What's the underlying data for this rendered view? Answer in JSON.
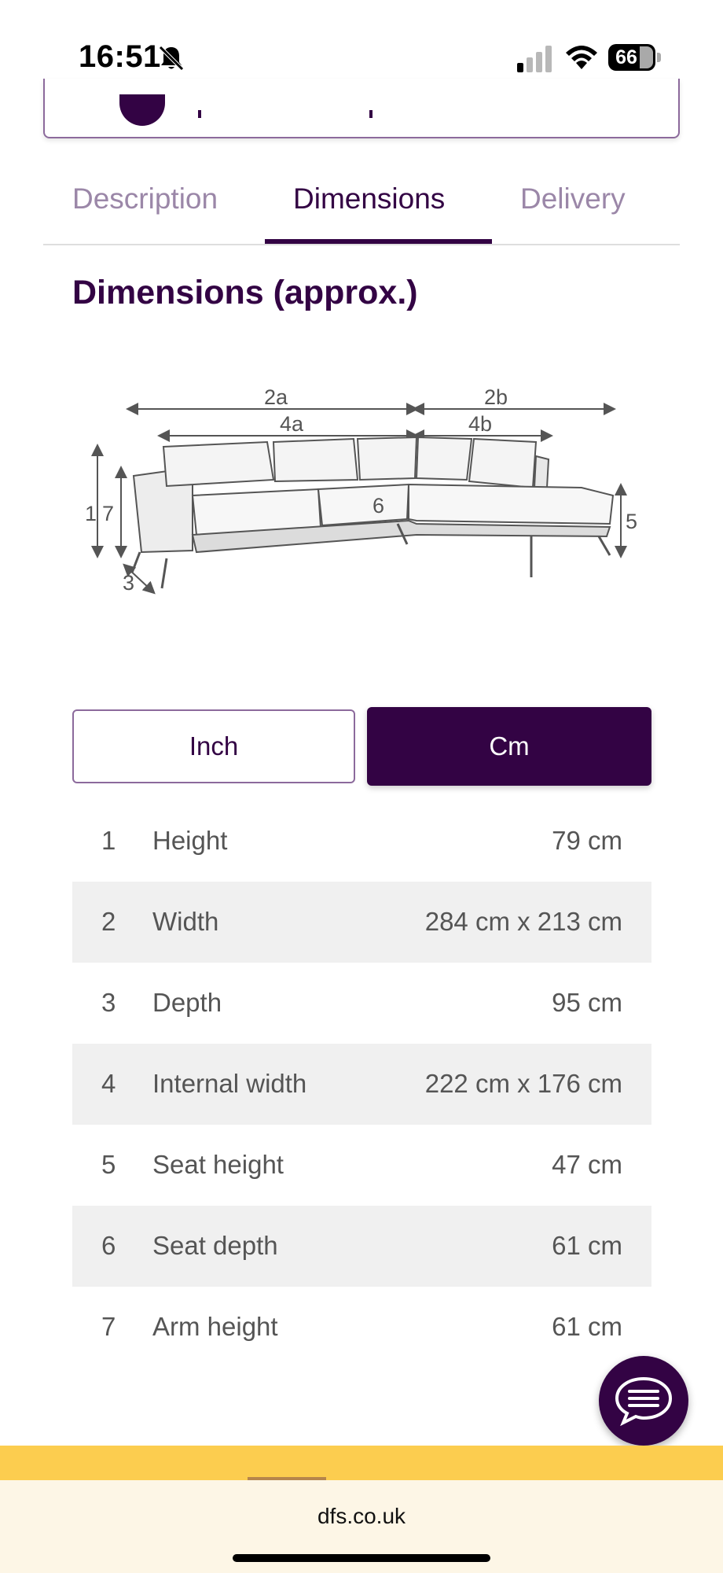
{
  "status_bar": {
    "time": "16:51",
    "battery": "66"
  },
  "tabs": [
    {
      "label": "Description"
    },
    {
      "label": "Dimensions"
    },
    {
      "label": "Delivery"
    }
  ],
  "section_title": "Dimensions (approx.)",
  "diagram": {
    "labels": [
      "2a",
      "2b",
      "4a",
      "4b",
      "1",
      "7",
      "6",
      "5",
      "3"
    ]
  },
  "unit_toggle": {
    "inch_label": "Inch",
    "cm_label": "Cm",
    "selected": "Cm"
  },
  "dimensions": [
    {
      "num": "1",
      "label": "Height",
      "value": "79 cm"
    },
    {
      "num": "2",
      "label": "Width",
      "value": "284 cm x 213 cm"
    },
    {
      "num": "3",
      "label": "Depth",
      "value": "95 cm"
    },
    {
      "num": "4",
      "label": "Internal width",
      "value": "222 cm x 176 cm"
    },
    {
      "num": "5",
      "label": "Seat height",
      "value": "47 cm"
    },
    {
      "num": "6",
      "label": "Seat depth",
      "value": "61 cm"
    },
    {
      "num": "7",
      "label": "Arm height",
      "value": "61 cm"
    }
  ],
  "browser": {
    "url": "dfs.co.uk"
  },
  "colors": {
    "brand": "#330344",
    "accent_yellow": "#fccd4f"
  }
}
